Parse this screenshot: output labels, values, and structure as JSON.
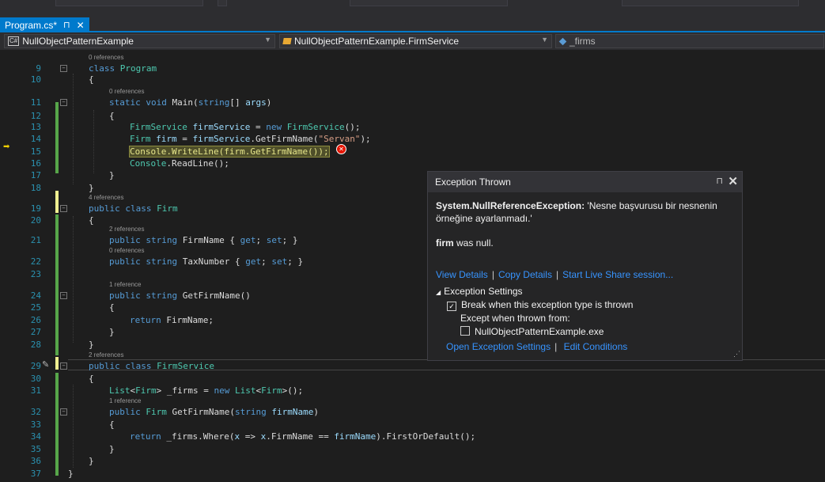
{
  "tab": {
    "title": "Program.cs*",
    "pin": "⊓",
    "close": "✕"
  },
  "navbar": {
    "project": "NullObjectPatternExample",
    "class": "NullObjectPatternExample.FirmService",
    "member": "_firms"
  },
  "lines": [
    {
      "n": "9",
      "lens": "0 references",
      "code": "class Program"
    },
    {
      "n": "10",
      "code": "{"
    },
    {
      "n": "11",
      "lens": "0 references",
      "code": "static void Main(string[] args)"
    },
    {
      "n": "12",
      "code": "{"
    },
    {
      "n": "13",
      "code": "FirmService firmService = new FirmService();"
    },
    {
      "n": "14",
      "code": "Firm firm = firmService.GetFirmName(\"Servan\");"
    },
    {
      "n": "15",
      "code": "Console.WriteLine(firm.GetFirmName());"
    },
    {
      "n": "16",
      "code": "Console.ReadLine();"
    },
    {
      "n": "17",
      "code": "}"
    },
    {
      "n": "18",
      "code": "}"
    },
    {
      "n": "19",
      "lens": "4 references",
      "code": "public class Firm"
    },
    {
      "n": "20",
      "code": "{"
    },
    {
      "n": "21",
      "lens": "2 references",
      "code": "public string FirmName { get; set; }"
    },
    {
      "n": "22",
      "lens": "0 references",
      "code": "public string TaxNumber { get; set; }"
    },
    {
      "n": "23",
      "code": ""
    },
    {
      "n": "24",
      "lens": "1 reference",
      "code": "public string GetFirmName()"
    },
    {
      "n": "25",
      "code": "{"
    },
    {
      "n": "26",
      "code": "return FirmName;"
    },
    {
      "n": "27",
      "code": "}"
    },
    {
      "n": "28",
      "code": "}"
    },
    {
      "n": "29",
      "lens": "2 references",
      "code": "public class FirmService"
    },
    {
      "n": "30",
      "code": "{"
    },
    {
      "n": "31",
      "code": "List<Firm> _firms = new List<Firm>();"
    },
    {
      "n": "32",
      "lens": "1 reference",
      "code": "public Firm GetFirmName(string firmName)"
    },
    {
      "n": "33",
      "code": "{"
    },
    {
      "n": "34",
      "code": "return _firms.Where(x => x.FirmName == firmName).FirstOrDefault();"
    },
    {
      "n": "35",
      "code": "}"
    },
    {
      "n": "36",
      "code": "}"
    },
    {
      "n": "37",
      "code": "}"
    }
  ],
  "exception": {
    "title": "Exception Thrown",
    "type": "System.NullReferenceException:",
    "message": " 'Nesne başvurusu bir nesnenin örneğine ayarlanmadı.'",
    "var": "firm",
    "var_note": " was null.",
    "links": [
      "View Details",
      "Copy Details",
      "Start Live Share session..."
    ],
    "settings_title": "Exception Settings",
    "break_label": "Break when this exception type is thrown",
    "except_label": "Except when thrown from:",
    "module_label": "NullObjectPatternExample.exe",
    "bottom_links": [
      "Open Exception Settings",
      "Edit Conditions"
    ]
  },
  "colors": {
    "accent": "#007acc",
    "error": "#e51400"
  }
}
